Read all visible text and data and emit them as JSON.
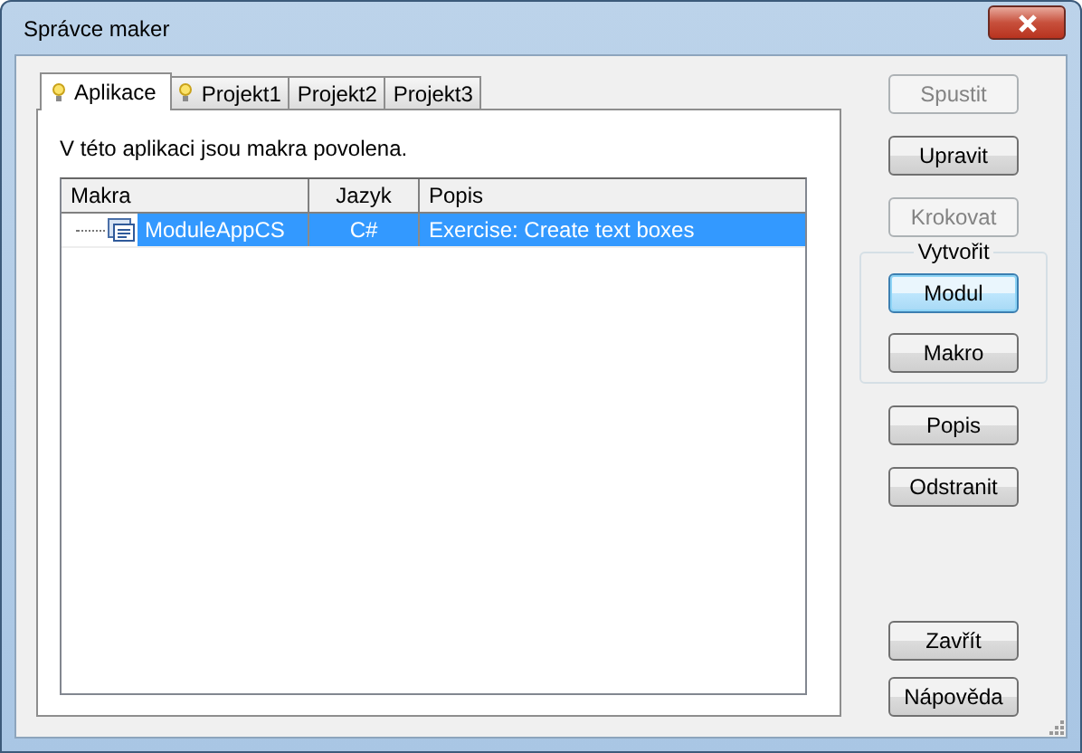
{
  "window": {
    "title": "Správce maker"
  },
  "tabs": [
    {
      "label": "Aplikace",
      "selected": true,
      "bulb": true
    },
    {
      "label": "Projekt1",
      "selected": false,
      "bulb": true
    },
    {
      "label": "Projekt2",
      "selected": false,
      "bulb": false
    },
    {
      "label": "Projekt3",
      "selected": false,
      "bulb": false
    }
  ],
  "message": "V této aplikaci jsou makra povolena.",
  "table": {
    "columns": [
      "Makra",
      "Jazyk",
      "Popis"
    ],
    "rows": [
      {
        "name": "ModuleAppCS",
        "language": "C#",
        "description": "Exercise: Create text boxes",
        "selected": true
      }
    ]
  },
  "actions": [
    {
      "kind": "button",
      "label": "Spustit",
      "disabled": true,
      "focused": false
    },
    {
      "kind": "button",
      "label": "Upravit",
      "disabled": false,
      "focused": false
    },
    {
      "kind": "button",
      "label": "Krokovat",
      "disabled": true,
      "focused": false
    },
    {
      "kind": "group",
      "title": "Vytvořit",
      "buttons": [
        {
          "label": "Modul",
          "disabled": false,
          "focused": true
        },
        {
          "label": "Makro",
          "disabled": false,
          "focused": false
        }
      ]
    },
    {
      "kind": "button",
      "label": "Popis",
      "disabled": false,
      "focused": false
    },
    {
      "kind": "button",
      "label": "Odstranit",
      "disabled": false,
      "focused": false
    }
  ],
  "footer_buttons": [
    {
      "label": "Zavřít",
      "disabled": false,
      "focused": false
    },
    {
      "label": "Nápověda",
      "disabled": false,
      "focused": false
    }
  ]
}
